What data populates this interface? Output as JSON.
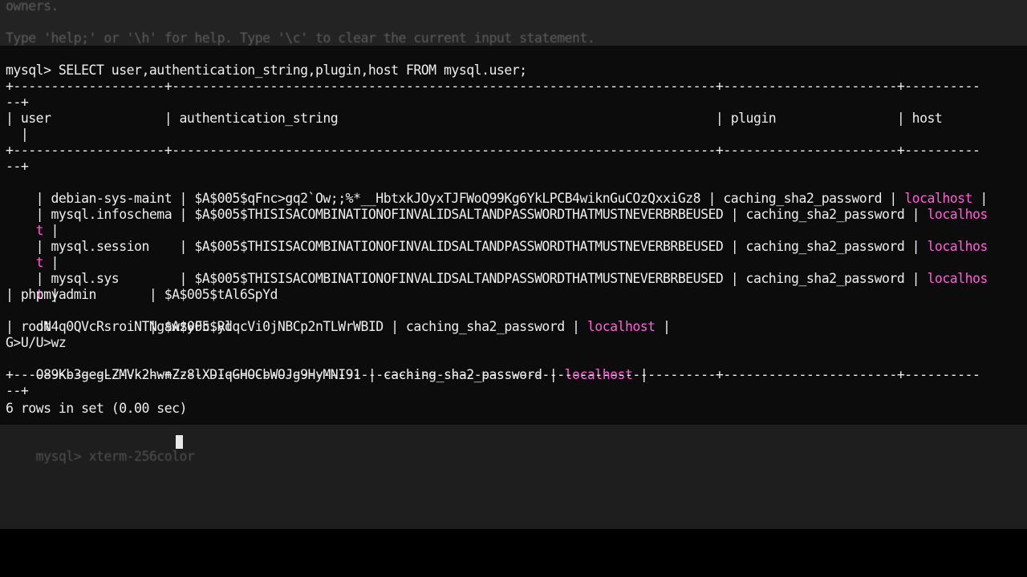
{
  "terminal": {
    "header_owners": "owners.",
    "help_hint": "Type 'help;' or '\\h' for help. Type '\\c' to clear the current input statement.",
    "query_line": "mysql> SELECT user,authentication_string,plugin,host FROM mysql.user;",
    "border_line": "+--------------------+------------------------------------------------------------------------+-----------------------+----------",
    "border_wrap": "--+",
    "header_row": "| user               | authentication_string                                                  | plugin                | host",
    "header_wrap": "  |",
    "rows": [
      {
        "part1": "| debian-sys-maint | $A$005$qFnc>gq2`Ow;;%*__HbtxkJOyxTJFWoQ99Kg6YkLPCB4wiknGuCOzQxxiGz8 | caching_sha2_password | ",
        "host": "localhost",
        "part2": " |"
      },
      {
        "part1": "| mysql.infoschema | $A$005$THISISACOMBINATIONOFINVALIDSALTANDPASSWORDTHATMUSTNEVERBRBEUSED | caching_sha2_password | ",
        "host": "localhos",
        "wrap_host": "t",
        "wrap_rest": " |"
      },
      {
        "part1": "| mysql.session    | $A$005$THISISACOMBINATIONOFINVALIDSALTANDPASSWORDTHATMUSTNEVERBRBEUSED | caching_sha2_password | ",
        "host": "localhos",
        "wrap_host": "t",
        "wrap_rest": " |"
      },
      {
        "part1": "| mysql.sys        | $A$005$THISISACOMBINATIONOFINVALIDSALTANDPASSWORDTHATMUSTNEVERBRBEUSED | caching_sha2_password | ",
        "host": "localhos",
        "wrap_host": "t",
        "wrap_rest": " |"
      }
    ],
    "phpmyadmin_line1": "| phpmyadmin       | $A$005$tAl6SpYd",
    "phpmyadmin_line2": "dN4q0QVcRsroiNTNgawzyFc.RdqcVi0jNBCp2nTLWrWBID | caching_sha2_password | ",
    "phpmyadmin_host": "localhost",
    "phpmyadmin_end": " |",
    "root_line1": "| root             | $A$005$yl",
    "root_line2": "G>U/U>wz",
    "root_line3": "O89Kb3gegLZMVk2hwnZz8lXDIqGHOCbWOJg9HyMNI91 | caching_sha2_password | ",
    "root_host": "localhost",
    "root_end": " |",
    "rows_summary": "6 rows in set (0.00 sec)",
    "prompt": "mysql> ",
    "typed_text": "xterm-256color"
  },
  "colors": {
    "background": "#0c0c0c",
    "text": "#eeeeee",
    "host_highlight": "#ff5fd7"
  }
}
